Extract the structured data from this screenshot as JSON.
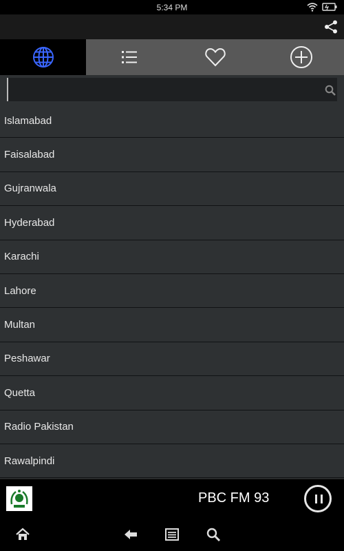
{
  "status_bar": {
    "time": "5:34 PM"
  },
  "tabs": [
    {
      "name": "globe",
      "active": true
    },
    {
      "name": "list",
      "active": false
    },
    {
      "name": "heart",
      "active": false
    },
    {
      "name": "add",
      "active": false
    }
  ],
  "search": {
    "value": "",
    "placeholder": ""
  },
  "cities": [
    "Islamabad",
    "Faisalabad",
    "Gujranwala",
    "Hyderabad",
    "Karachi",
    "Lahore",
    "Multan",
    "Peshawar",
    "Quetta",
    "Radio Pakistan",
    "Rawalpindi"
  ],
  "player": {
    "station": "PBC FM 93",
    "state": "playing"
  },
  "colors": {
    "list_bg": "#2e3133",
    "tab_bar": "#585858",
    "accent_blue": "#3366ff"
  }
}
